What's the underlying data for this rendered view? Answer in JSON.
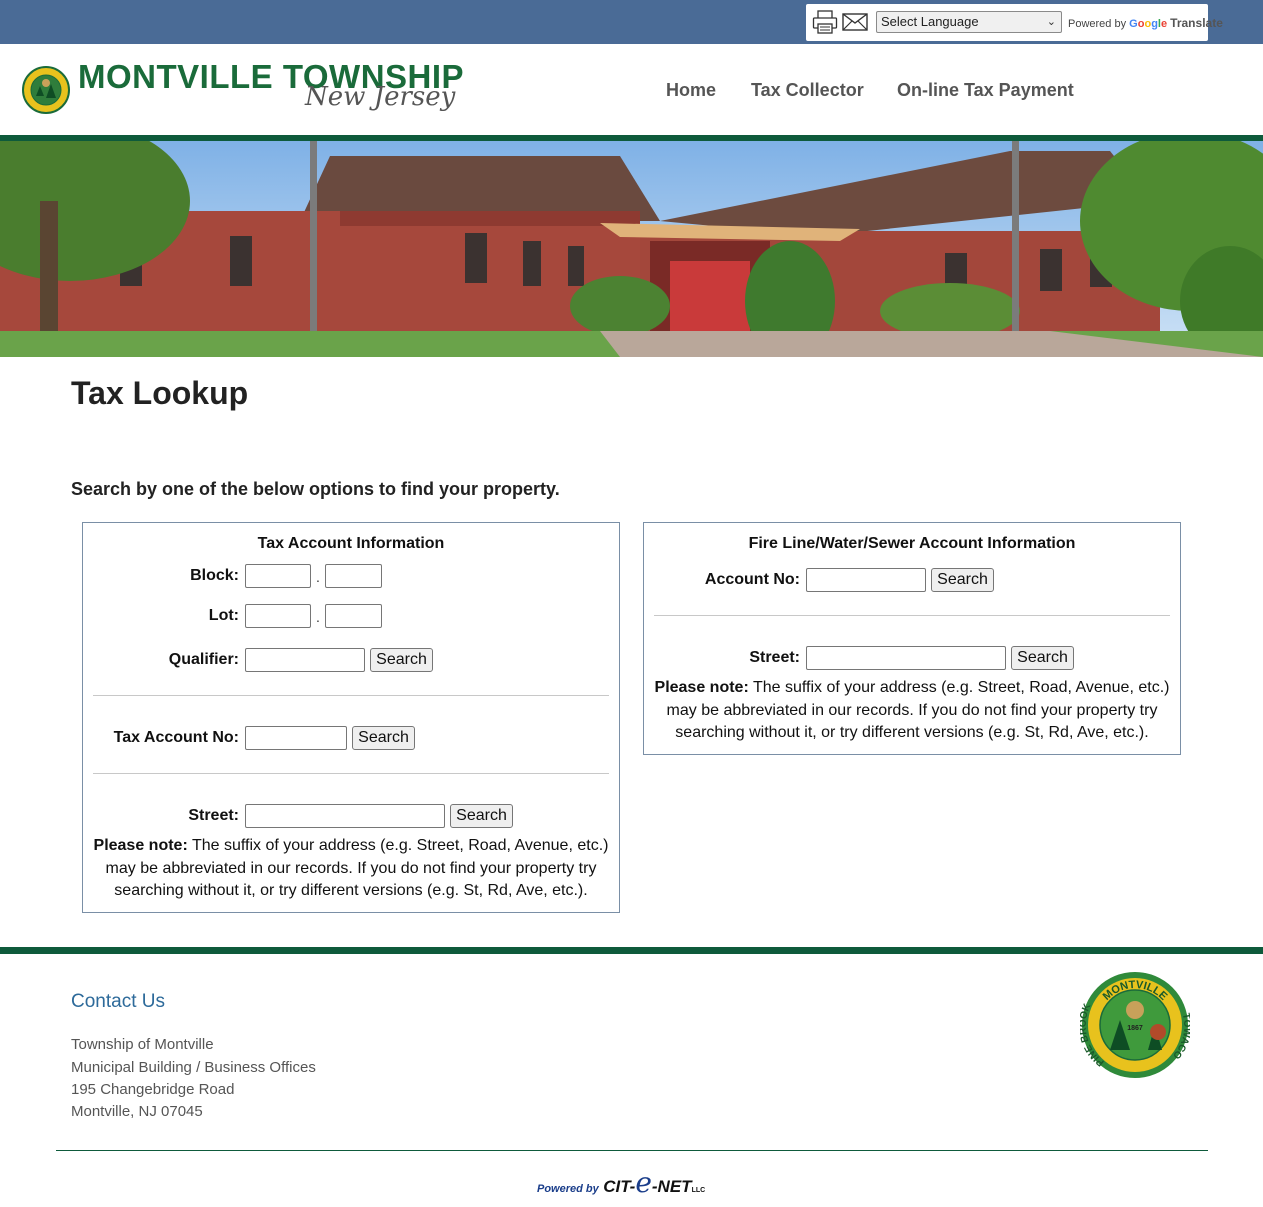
{
  "utility": {
    "language_select": "Select Language",
    "powered_by": "Powered by",
    "google": [
      "G",
      "o",
      "o",
      "g",
      "l",
      "e"
    ],
    "translate": "Translate"
  },
  "header": {
    "logo_title": "MONTVILLE TOWNSHIP",
    "logo_subtitle": "New Jersey",
    "nav": [
      "Home",
      "Tax Collector",
      "On-line Tax Payment"
    ]
  },
  "main": {
    "title": "Tax Lookup",
    "intro": "Search by one of the below options to find your property.",
    "tax_panel": {
      "title": "Tax Account Information",
      "block_label": "Block:",
      "lot_label": "Lot:",
      "qualifier_label": "Qualifier:",
      "account_label": "Tax Account No:",
      "street_label": "Street:",
      "search_label": "Search",
      "separator": ".",
      "note_bold": "Please note:",
      "note_text": " The suffix of your address (e.g. Street, Road, Avenue, etc.) may be abbreviated in our records. If you do not find your property try searching without it, or try different versions (e.g. St, Rd, Ave, etc.)."
    },
    "utility_panel": {
      "title": "Fire Line/Water/Sewer Account Information",
      "account_label": "Account No:",
      "street_label": "Street:",
      "search_label": "Search",
      "note_bold": "Please note:",
      "note_text": " The suffix of your address (e.g. Street, Road, Avenue, etc.) may be abbreviated in our records. If you do not find your property try searching without it, or try different versions (e.g. St, Rd, Ave, etc.)."
    }
  },
  "footer": {
    "contact_title": "Contact Us",
    "address": [
      "Township of Montville",
      "Municipal Building / Business Offices",
      "195 Changebridge Road",
      "Montville, NJ 07045"
    ],
    "seal_top": "MONTVILLE",
    "seal_left": "PINE BROOK",
    "seal_right": "TOWACO",
    "seal_year": "1867",
    "powered_by": "Powered by",
    "brand_a": "CIT-",
    "brand_e": "e",
    "brand_b": "-NET",
    "brand_llc": "LLC"
  },
  "colors": {
    "topbar": "#4a6b96",
    "brand_green": "#0e5a3b",
    "logo_green": "#1a6b3a",
    "contact_blue": "#2d6a9a",
    "panel_border": "#7a8fa6"
  },
  "icons": [
    "printer-icon",
    "envelope-icon",
    "chevron-down-icon"
  ]
}
